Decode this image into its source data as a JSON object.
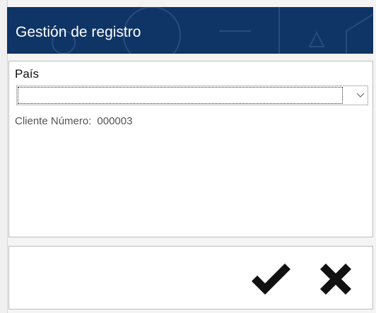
{
  "header": {
    "title": "Gestión de registro"
  },
  "form": {
    "country_label": "País",
    "country_value": "",
    "client_number_label": "Cliente Número:",
    "client_number_value": "000003"
  },
  "icons": {
    "combo_arrow": "chevron-down-icon",
    "accept": "checkmark-icon",
    "cancel": "close-icon"
  },
  "colors": {
    "header_bg": "#0f3466",
    "header_text": "#ffffff",
    "icon": "#111111"
  }
}
